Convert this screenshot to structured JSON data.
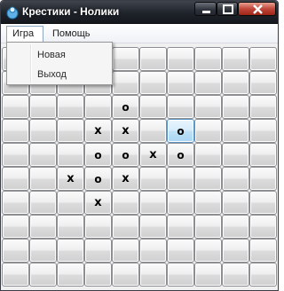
{
  "window": {
    "title": "Крестики - Нолики",
    "app_icon": "tic-tac-toe-app-icon",
    "controls": [
      "minimize-icon",
      "maximize-icon",
      "close-icon"
    ]
  },
  "menubar": {
    "items": [
      {
        "label": "Игра",
        "open": true
      },
      {
        "label": "Помощь",
        "open": false
      }
    ]
  },
  "game_menu": {
    "items": [
      {
        "label": "Новая"
      },
      {
        "label": "Выход"
      }
    ]
  },
  "board": {
    "size": 10,
    "highlight_color": "#bfe1f7",
    "highlighted_cell": [
      3,
      6
    ],
    "rows": [
      [
        "",
        "",
        "",
        "",
        "",
        "",
        "",
        "",
        "",
        ""
      ],
      [
        "",
        "",
        "",
        "",
        "",
        "",
        "",
        "",
        "",
        ""
      ],
      [
        "",
        "",
        "",
        "",
        "o",
        "",
        "",
        "",
        "",
        ""
      ],
      [
        "",
        "",
        "",
        "x",
        "x",
        "",
        "o",
        "",
        "",
        ""
      ],
      [
        "",
        "",
        "",
        "o",
        "o",
        "x",
        "o",
        "",
        "",
        ""
      ],
      [
        "",
        "",
        "x",
        "o",
        "x",
        "",
        "",
        "",
        "",
        ""
      ],
      [
        "",
        "",
        "",
        "x",
        "",
        "",
        "",
        "",
        "",
        ""
      ],
      [
        "",
        "",
        "",
        "",
        "",
        "",
        "",
        "",
        "",
        ""
      ],
      [
        "",
        "",
        "",
        "",
        "",
        "",
        "",
        "",
        "",
        ""
      ],
      [
        "",
        "",
        "",
        "",
        "",
        "",
        "",
        "",
        "",
        ""
      ]
    ]
  }
}
